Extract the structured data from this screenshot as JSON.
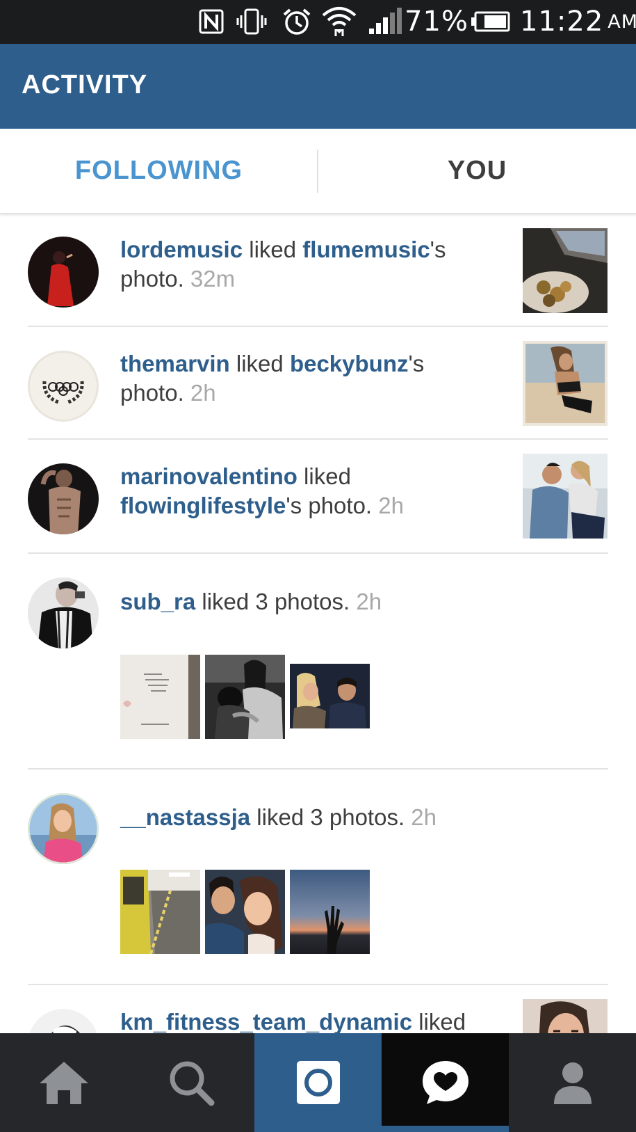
{
  "status_bar": {
    "battery_percent": "71%",
    "time": "11:22",
    "ampm": "AM",
    "icons": [
      "nfc-icon",
      "vibrate-icon",
      "alarm-icon",
      "wifi-icon",
      "signal-icon",
      "battery-icon"
    ]
  },
  "header": {
    "title": "ACTIVITY"
  },
  "tabs": [
    {
      "label": "FOLLOWING",
      "active": true
    },
    {
      "label": "YOU",
      "active": false
    }
  ],
  "feed": [
    {
      "user": "lordemusic",
      "verb": " liked ",
      "target": "flumemusic",
      "suffix": "'s",
      "line2": "photo.",
      "time": "32m"
    },
    {
      "user": "themarvin",
      "verb": " liked ",
      "target": "beckybunz",
      "suffix": "'s",
      "line2": "photo.",
      "time": "2h"
    },
    {
      "user": "marinovalentino",
      "verb": " liked",
      "target": "flowinglifestyle",
      "suffix": "'s photo.",
      "time": "2h"
    },
    {
      "user": "sub_ra",
      "text": " liked 3 photos.",
      "time": "2h"
    },
    {
      "user": "__nastassja",
      "text": " liked 3 photos.",
      "time": "2h"
    },
    {
      "user": "km_fitness_team_dynamic",
      "verb": " liked"
    }
  ],
  "bottom_nav": {
    "items": [
      {
        "name": "home",
        "icon": "home-icon"
      },
      {
        "name": "search",
        "icon": "search-icon"
      },
      {
        "name": "camera",
        "icon": "camera-icon"
      },
      {
        "name": "activity",
        "icon": "activity-heart-icon",
        "active": true
      },
      {
        "name": "profile",
        "icon": "profile-icon"
      }
    ]
  },
  "colors": {
    "header_bg": "#2e5e8c",
    "username": "#2e5e8c",
    "active_tab": "#4a94cf",
    "nav_bg": "#25272b",
    "status_bg": "#1b1c1e"
  }
}
